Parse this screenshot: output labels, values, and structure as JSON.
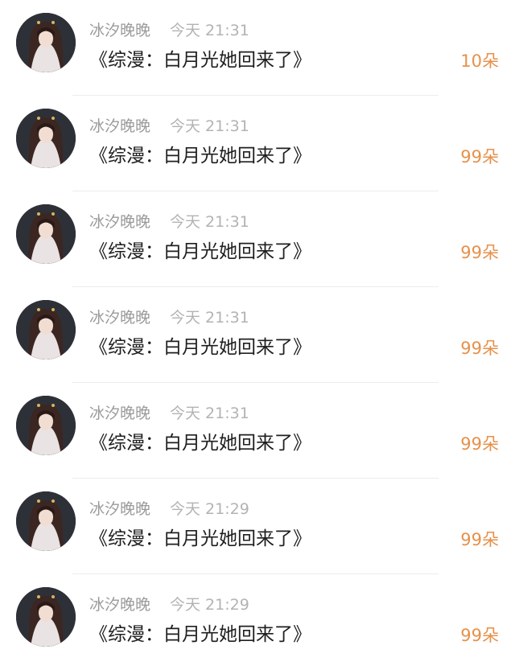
{
  "colors": {
    "name": "#9a9a9a",
    "time": "#b3b3b3",
    "message": "#1f1f1f",
    "gift": "#e6914a",
    "divider": "#ececec"
  },
  "messages": [
    {
      "name": "冰汐晚晚",
      "time": "今天 21:31",
      "text": "《综漫：白月光她回来了》",
      "gift": "10朵",
      "avatar_icon": "user-avatar-icon"
    },
    {
      "name": "冰汐晚晚",
      "time": "今天 21:31",
      "text": "《综漫：白月光她回来了》",
      "gift": "99朵",
      "avatar_icon": "user-avatar-icon"
    },
    {
      "name": "冰汐晚晚",
      "time": "今天 21:31",
      "text": "《综漫：白月光她回来了》",
      "gift": "99朵",
      "avatar_icon": "user-avatar-icon"
    },
    {
      "name": "冰汐晚晚",
      "time": "今天 21:31",
      "text": "《综漫：白月光她回来了》",
      "gift": "99朵",
      "avatar_icon": "user-avatar-icon"
    },
    {
      "name": "冰汐晚晚",
      "time": "今天 21:31",
      "text": "《综漫：白月光她回来了》",
      "gift": "99朵",
      "avatar_icon": "user-avatar-icon"
    },
    {
      "name": "冰汐晚晚",
      "time": "今天 21:29",
      "text": "《综漫：白月光她回来了》",
      "gift": "99朵",
      "avatar_icon": "user-avatar-icon"
    },
    {
      "name": "冰汐晚晚",
      "time": "今天 21:29",
      "text": "《综漫：白月光她回来了》",
      "gift": "99朵",
      "avatar_icon": "user-avatar-icon"
    }
  ]
}
